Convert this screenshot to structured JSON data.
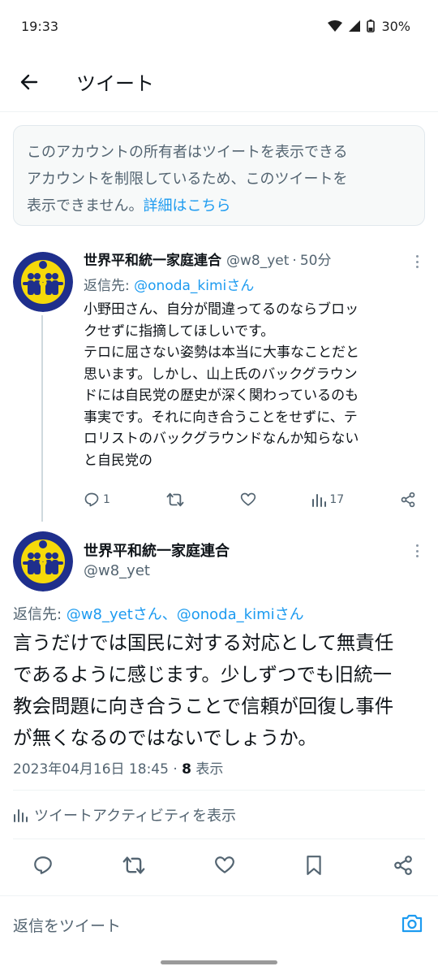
{
  "status": {
    "time": "19:33",
    "battery": "30%"
  },
  "header": {
    "title": "ツイート"
  },
  "notice": {
    "line1": "このアカウントの所有者はツイートを表示できる",
    "line2": "アカウントを制限しているため、このツイートを",
    "line3": "表示できません。",
    "link": "詳細はこちら"
  },
  "tweet1": {
    "name": "世界平和統一家庭連合",
    "handle": "@w8_yet",
    "sep": "·",
    "time": "50分",
    "reply_prefix": "返信先: ",
    "reply_to": "@onoda_kimiさん",
    "body": [
      "小野田さん、自分が間違ってるのならブロッ",
      "クせずに指摘してほしいです。",
      "テロに屈さない姿勢は本当に大事なことだと",
      "思います。しかし、山上氏のバックグラウン",
      "ドには自民党の歴史が深く関わっているのも",
      "事実です。それに向き合うことをせずに、テ",
      "ロリストのバックグラウンドなんか知らない",
      "と自民党の"
    ],
    "reply_count": "1",
    "views": "17"
  },
  "tweet2": {
    "name": "世界平和統一家庭連合",
    "handle": "@w8_yet",
    "reply_prefix": "返信先: ",
    "reply_to_1": "@w8_yetさん",
    "reply_sep": "、",
    "reply_to_2": "@onoda_kimiさん",
    "body": [
      "言うだけでは国民に対する対応として無責任",
      "であるように感じます。少しずつでも旧統一",
      "教会問題に向き合うことで信頼が回復し事件",
      "が無くなるのではないでしょうか。"
    ],
    "datetime": "2023年04月16日 18:45",
    "meta_sep": " · ",
    "views": "8",
    "views_label": " 表示",
    "activity": "ツイートアクティビティを表示"
  },
  "reply_bar": {
    "placeholder": "返信をツイート"
  },
  "colors": {
    "accent": "#1d9bf0",
    "muted": "#536471",
    "avatar_bg": "#1f2f8c",
    "avatar_fg": "#f5d90a"
  }
}
